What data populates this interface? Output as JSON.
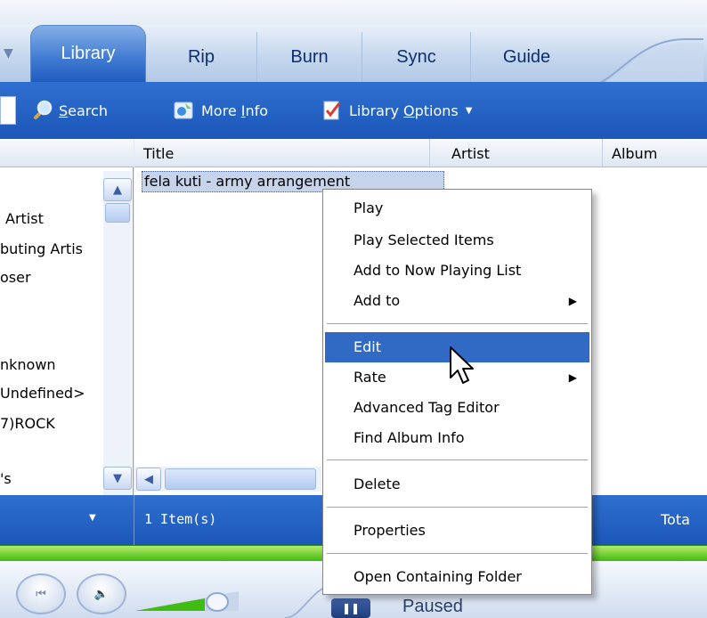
{
  "tabs": [
    {
      "label": "Library"
    },
    {
      "label": "Rip"
    },
    {
      "label": "Burn"
    },
    {
      "label": "Sync"
    },
    {
      "label": "Guide"
    }
  ],
  "toolbar": {
    "search_underlined": "S",
    "search_rest": "earch",
    "more_info_pre": "More ",
    "more_info_underlined": "I",
    "more_info_post": "nfo",
    "library_options_pre": "Library ",
    "library_options_underlined": "O",
    "library_options_post": "ptions",
    "dropdown_arrow": "▼"
  },
  "left_pane": {
    "items": [
      "Artist",
      "buting Artis",
      "oser",
      "nknown",
      "Undefined>",
      "7)ROCK",
      "'s"
    ]
  },
  "list": {
    "columns": [
      "Title",
      "Artist",
      "Album"
    ],
    "rows": [
      {
        "title": "fela kuti - army arrangement"
      }
    ]
  },
  "status": {
    "item_count": "1 Item(s)",
    "total_label": "Tota"
  },
  "player": {
    "state": "Paused"
  },
  "context_menu": {
    "items": [
      {
        "label": "Play"
      },
      {
        "label": "Play Selected Items"
      },
      {
        "label": "Add to Now Playing List"
      },
      {
        "label": "Add to",
        "submenu": true
      },
      {
        "label": "Edit",
        "highlighted": true
      },
      {
        "label": "Rate",
        "submenu": true
      },
      {
        "label": "Advanced Tag Editor"
      },
      {
        "label": "Find Album Info"
      },
      {
        "label": "Delete"
      },
      {
        "label": "Properties"
      },
      {
        "label": "Open Containing Folder"
      }
    ]
  },
  "icons": {
    "search": "search-magnifier-icon",
    "more_info": "more-info-icon",
    "library_options": "library-options-icon",
    "cursor": "mouse-pointer-icon",
    "scroll_up": "scroll-up-arrow-icon",
    "scroll_down": "scroll-down-arrow-icon",
    "scroll_left": "scroll-left-arrow-icon"
  },
  "colors": {
    "accent_blue": "#1f5cbf",
    "menu_highlight": "#316ac5",
    "progress_green": "#3fbb12"
  }
}
